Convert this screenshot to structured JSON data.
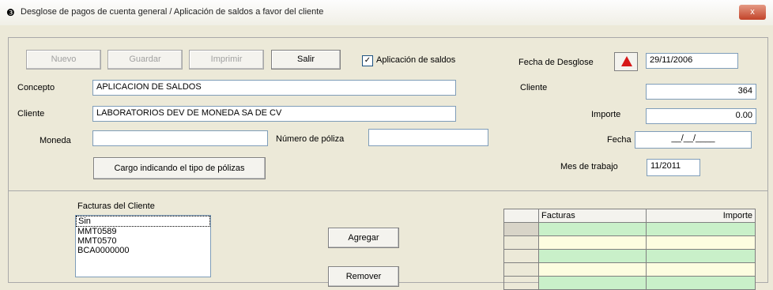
{
  "window": {
    "title": "Desglose de pagos de cuenta general / Aplicación de saldos a favor del cliente",
    "close_label": "x",
    "app_icon": "app-icon"
  },
  "toolbar": {
    "nuevo": "Nuevo",
    "guardar": "Guardar",
    "imprimir": "Imprimir",
    "salir": "Salir",
    "aplicacion_saldos_label": "Aplicación de saldos",
    "aplicacion_saldos_checked": true
  },
  "form": {
    "concepto_label": "Concepto",
    "concepto_value": "APLICACION DE SALDOS",
    "cliente_label": "Cliente",
    "cliente_value": "LABORATORIOS DEV DE MONEDA SA DE CV",
    "moneda_label": "Moneda",
    "moneda_value": "",
    "numero_poliza_label": "Número de póliza",
    "numero_poliza_value": "",
    "cargo_button": "Cargo indicando el tipo de pólizas"
  },
  "right": {
    "fecha_desglose_label": "Fecha de Desglose",
    "fecha_desglose_value": "29/11/2006",
    "cliente_label": "Cliente",
    "cliente_value": "364",
    "importe_label": "Importe",
    "importe_value": "0.00",
    "fecha_label": "Fecha",
    "fecha_value": "__/__/____",
    "mes_label": "Mes de trabajo",
    "mes_value": "11/2011"
  },
  "lower": {
    "facturas_label": "Facturas del Cliente",
    "facturas": [
      "Sin",
      "MMT0589",
      "MMT0570",
      "BCA0000000"
    ],
    "agregar": "Agregar",
    "remover": "Remover",
    "grid_headers": [
      "Facturas",
      "Importe"
    ],
    "grid_rows": [
      {
        "factura": "",
        "importe": ""
      },
      {
        "factura": "",
        "importe": ""
      },
      {
        "factura": "",
        "importe": ""
      },
      {
        "factura": "",
        "importe": ""
      },
      {
        "factura": "",
        "importe": ""
      }
    ]
  },
  "colors": {
    "window_bg": "#ece9d8",
    "grid_green": "#c9f0c9",
    "grid_light": "#fdfde0",
    "warn_red": "#d71818"
  }
}
